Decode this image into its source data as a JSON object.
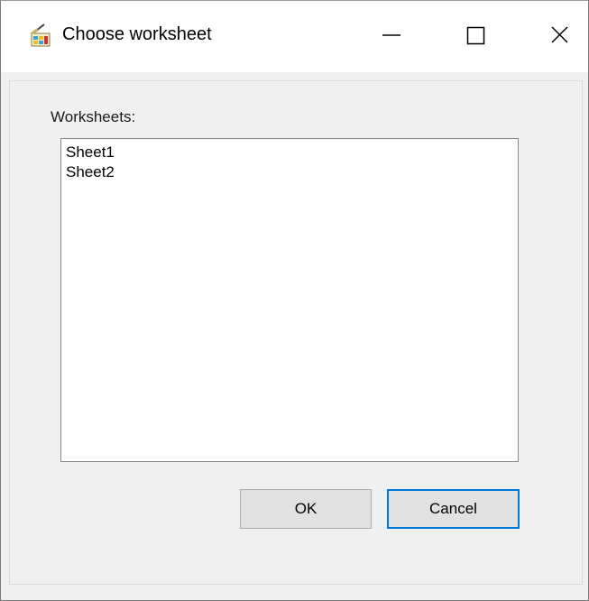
{
  "window": {
    "title": "Choose worksheet",
    "app_icon": "spreadsheet-app-icon"
  },
  "titlebar_controls": {
    "minimize_icon": "minimize-icon",
    "maximize_icon": "maximize-icon",
    "close_icon": "close-icon"
  },
  "worksheets": {
    "label": "Worksheets:",
    "items": [
      "Sheet1",
      "Sheet2"
    ]
  },
  "buttons": {
    "ok_label": "OK",
    "cancel_label": "Cancel"
  },
  "colors": {
    "focus_border": "#0078d7",
    "dialog_background": "#f0f0f0"
  }
}
